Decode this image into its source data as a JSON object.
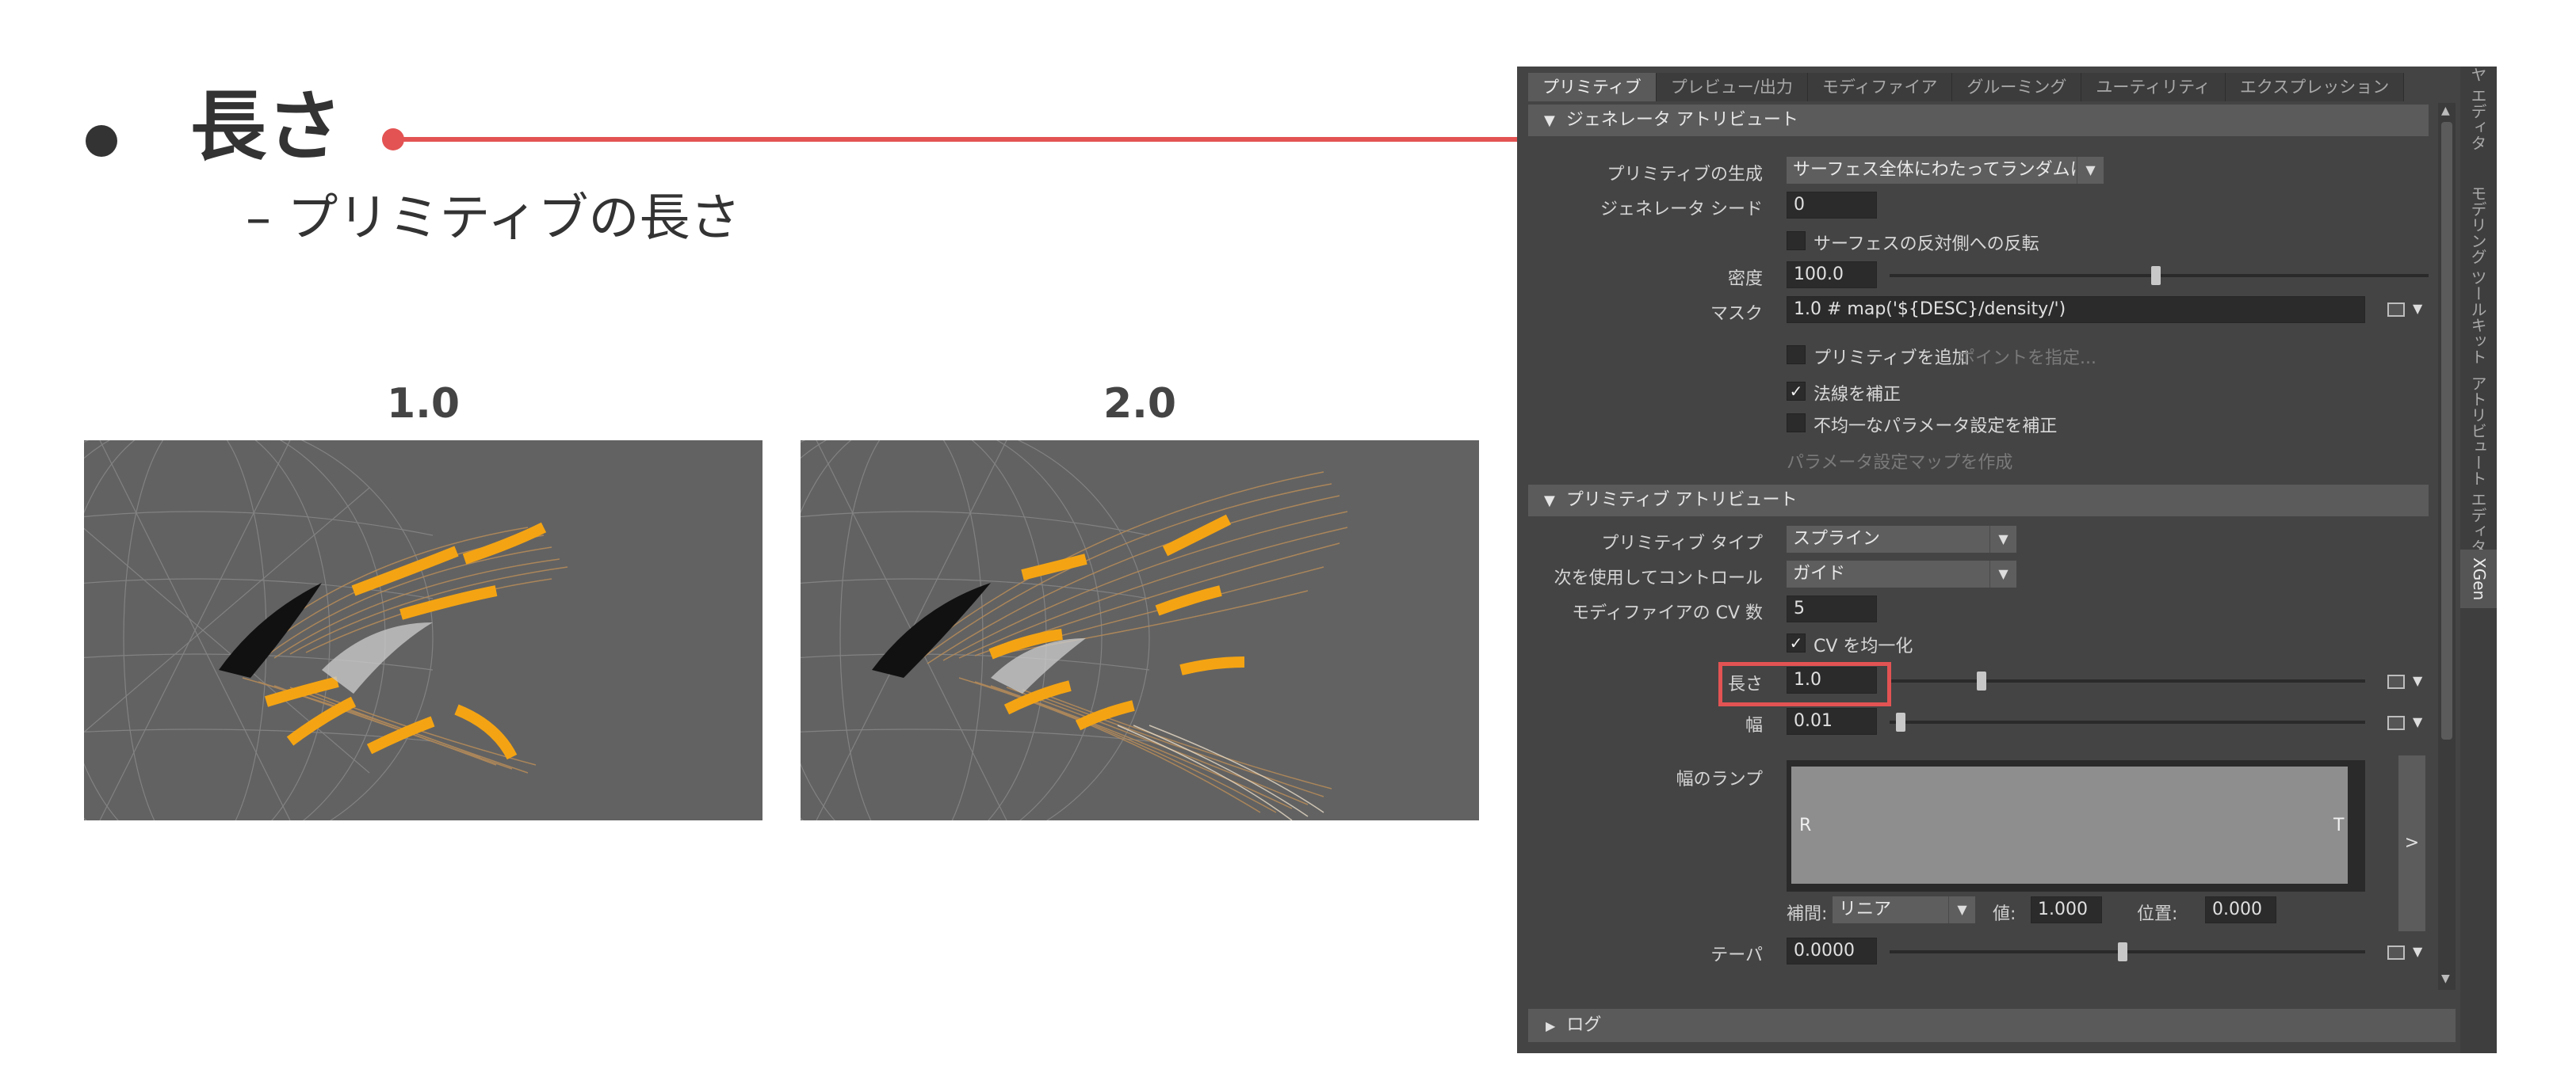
{
  "slide": {
    "title": "長さ",
    "subtitle": "– プリミティブの長さ"
  },
  "comparison": [
    {
      "label": "1.0"
    },
    {
      "label": "2.0"
    }
  ],
  "colors": {
    "callout": "#e35353",
    "panel_bg": "#444444",
    "preview_bg": "#626262",
    "hair_orange": "#f4a413",
    "hair_tan": "#b38a5a"
  },
  "panel": {
    "tabs": [
      "プリミティブ",
      "プレビュー/出力",
      "モディファイア",
      "グルーミング",
      "ユーティリティ",
      "エクスプレッション"
    ],
    "side_tabs": [
      "ヤ エディタ",
      "モデリング ツールキット",
      "アトリビュート エディタ",
      "XGen"
    ],
    "generator_section": {
      "header": "ジェネレータ アトリビュート",
      "primitive_gen_label": "プリミティブの生成",
      "primitive_gen_value": "サーフェス全体にわたってランダムに",
      "seed_label": "ジェネレータ シード",
      "seed_value": "0",
      "flip_label": "サーフェスの反対側への反転",
      "density_label": "密度",
      "density_value": "100.0",
      "mask_label": "マスク",
      "mask_value": "1.0 # map('${DESC}/density/')",
      "add_primitive_label": "プリミティブを追加",
      "specify_points_label": "ポイントを指定...",
      "normal_correct_label": "法線を補正",
      "nonuniform_label": "不均一なパラメータ設定を補正",
      "create_param_map_label": "パラメータ設定マップを作成"
    },
    "primitive_section": {
      "header": "プリミティブ アトリビュート",
      "type_label": "プリミティブ タイプ",
      "type_value": "スプライン",
      "control_label": "次を使用してコントロール",
      "control_value": "ガイド",
      "cv_label": "モディファイアの CV 数",
      "cv_value": "5",
      "cv_uniform_label": "CV を均一化",
      "length_label": "長さ",
      "length_value": "1.0",
      "width_label": "幅",
      "width_value": "0.01",
      "width_ramp_label": "幅のランプ",
      "ramp_left": "R",
      "ramp_right": "T",
      "ramp_button": ">",
      "interp_label": "補間:",
      "interp_value": "リニア",
      "value_label": "値:",
      "value_value": "1.000",
      "position_label": "位置:",
      "position_value": "0.000",
      "taper_label": "テーパ",
      "taper_value": "0.0000"
    },
    "log_label": "ログ"
  }
}
